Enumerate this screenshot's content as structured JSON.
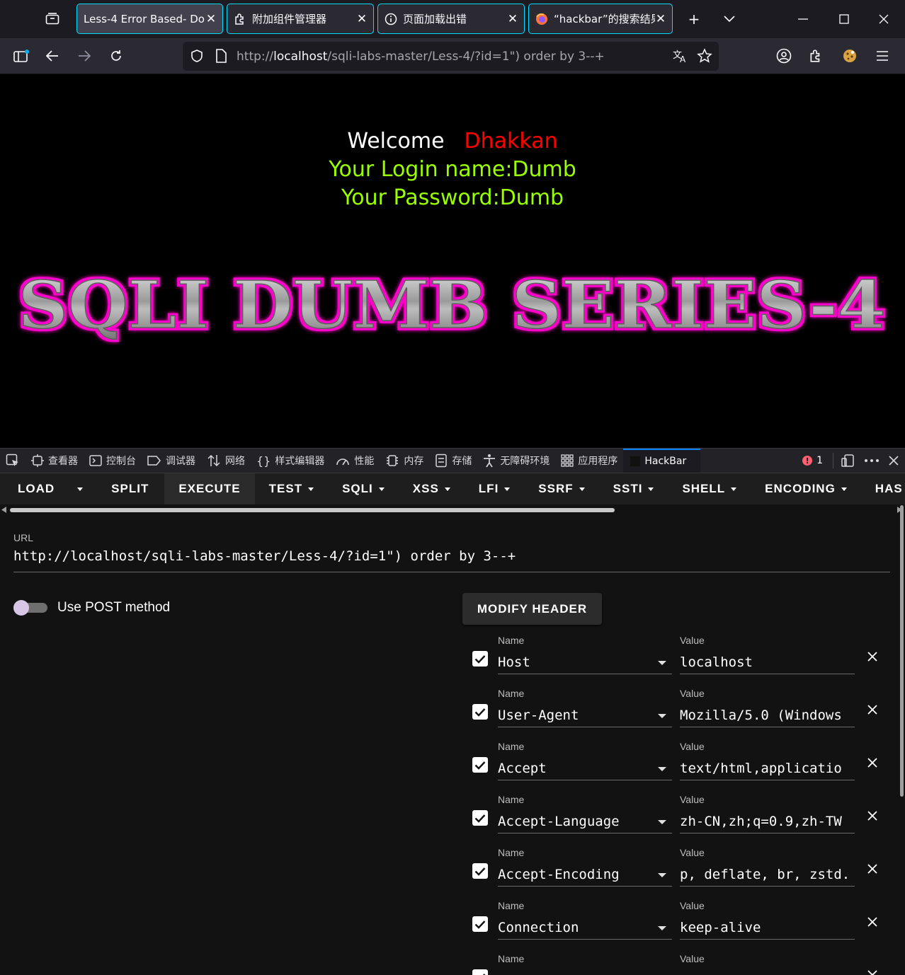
{
  "browser": {
    "tabs": [
      {
        "label": "Less-4 Error Based- Dou",
        "icon": "page-icon",
        "active": true
      },
      {
        "label": "附加组件管理器",
        "icon": "puzzle-icon",
        "active": false
      },
      {
        "label": "页面加载出错",
        "icon": "info-icon",
        "active": false
      },
      {
        "label": "“hackbar”的搜索结果",
        "icon": "firefox-icon",
        "active": false
      }
    ],
    "url_prefix": "http://",
    "url_host": "localhost",
    "url_rest": "/sqli-labs-master/Less-4/?id=1\") order by 3--+"
  },
  "page": {
    "welcome": "Welcome",
    "dhakkan": "Dhakkan",
    "login_line": "Your Login name:Dumb",
    "password_line": "Your Password:Dumb",
    "banner_text": "SQLI DUMB SERIES-4",
    "colors": {
      "welcome": "#ffffff",
      "dhakkan": "#ff0000",
      "login": "#99ff00",
      "banner_glow": "#ff00cc"
    }
  },
  "devtools": {
    "tabs": [
      "查看器",
      "控制台",
      "调试器",
      "网络",
      "样式编辑器",
      "性能",
      "内存",
      "存储",
      "无障碍环境",
      "应用程序",
      "HackBar"
    ],
    "error_count": "1"
  },
  "hackbar": {
    "menu": {
      "load": "LOAD",
      "split": "SPLIT",
      "execute": "EXECUTE",
      "test": "TEST",
      "sqli": "SQLI",
      "xss": "XSS",
      "lfi": "LFI",
      "ssrf": "SSRF",
      "ssti": "SSTI",
      "shell": "SHELL",
      "encoding": "ENCODING",
      "hash": "HAS"
    },
    "url_label": "URL",
    "url_value": "http://localhost/sqli-labs-master/Less-4/?id=1\") order by 3--+",
    "post_label": "Use POST method",
    "modify_header": "MODIFY HEADER",
    "name_label": "Name",
    "value_label": "Value",
    "headers": [
      {
        "name": "Host",
        "value": "localhost"
      },
      {
        "name": "User-Agent",
        "value": "Mozilla/5.0 (Windows"
      },
      {
        "name": "Accept",
        "value": "text/html,applicatio"
      },
      {
        "name": "Accept-Language",
        "value": "zh-CN,zh;q=0.9,zh-TW"
      },
      {
        "name": "Accept-Encoding",
        "value": ".p, deflate, br, zstd"
      },
      {
        "name": "Connection",
        "value": "keep-alive"
      },
      {
        "name": "",
        "value": ""
      }
    ]
  }
}
